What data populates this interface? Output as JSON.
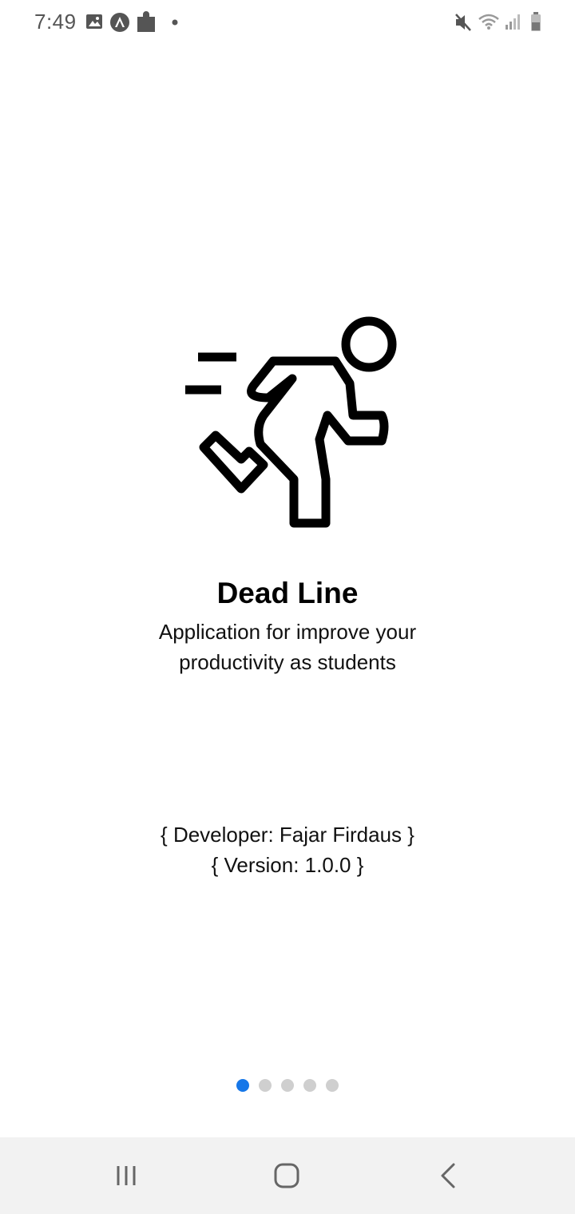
{
  "status_bar": {
    "time": "7:49",
    "left_icons": [
      "image-icon",
      "android-auto-icon",
      "puzzle-icon",
      "notification-dot-icon"
    ],
    "right_icons": [
      "mute-icon",
      "wifi-icon",
      "signal-icon",
      "battery-icon"
    ]
  },
  "hero": {
    "icon": "running-person-icon"
  },
  "app": {
    "title": "Dead Line",
    "subtitle": "Application for improve your productivity as students"
  },
  "info": {
    "developer": "{ Developer: Fajar Firdaus }",
    "version": "{ Version: 1.0.0 }"
  },
  "pager": {
    "total_pages": 5,
    "current_page": 1,
    "active_color": "#1677e8",
    "inactive_color": "#cfcfcf"
  },
  "nav_bar": {
    "buttons": [
      "recent-apps-icon",
      "home-icon",
      "back-icon"
    ]
  }
}
